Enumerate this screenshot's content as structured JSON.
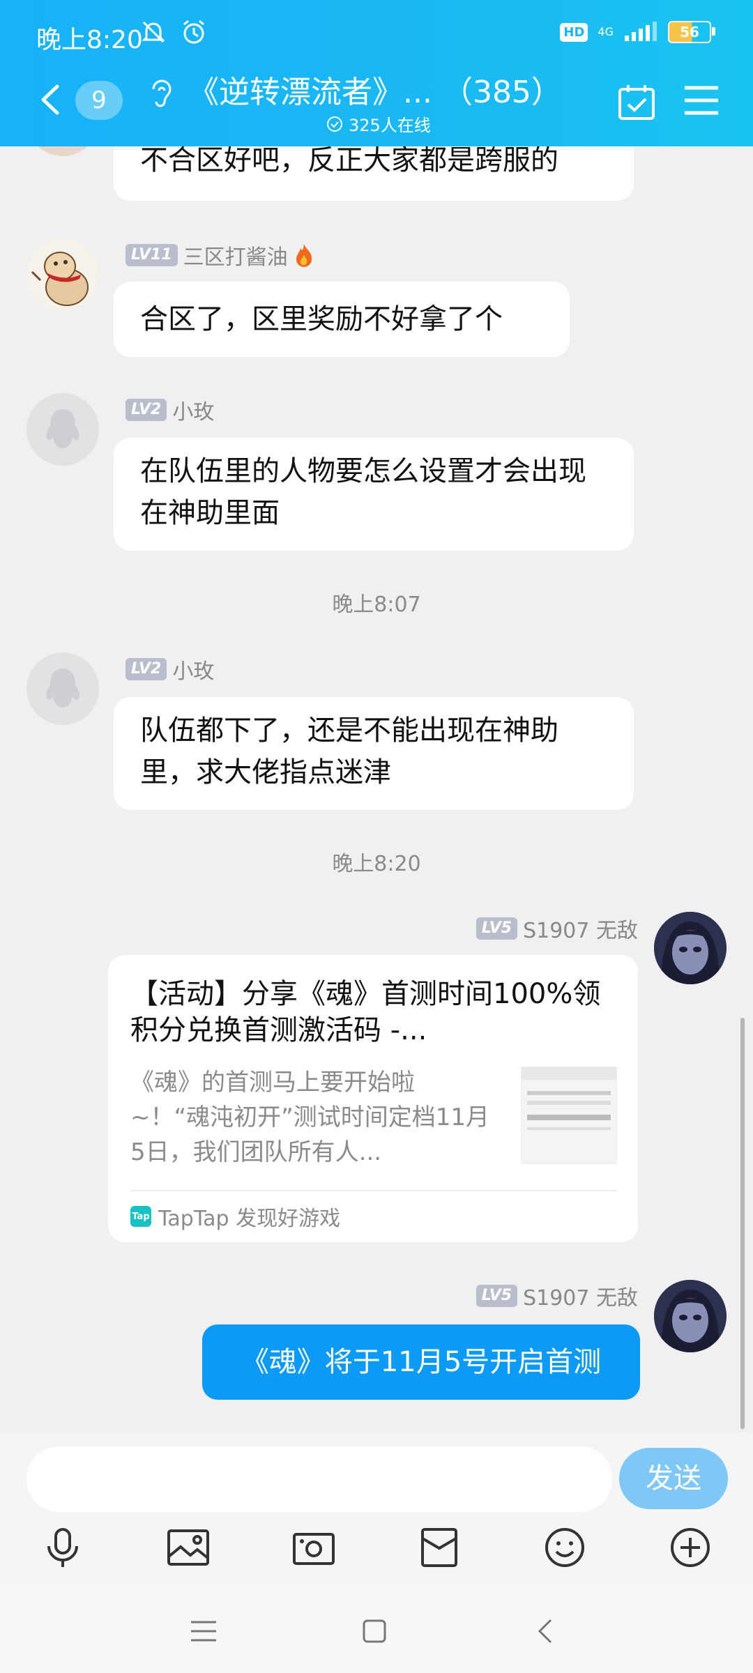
{
  "status_bar": {
    "time": "晚上8:20",
    "network": "4G",
    "battery": "56",
    "hd": "HD"
  },
  "header": {
    "unread_count": "9",
    "title": "《逆转漂流者》...  （385）",
    "online": "325人在线"
  },
  "messages": [
    {
      "sender": "",
      "level": "",
      "text": "不合区好吧，反正大家都是跨服的"
    },
    {
      "sender": "三区打酱油",
      "level": "LV11",
      "text": "合区了，区里奖励不好拿了个"
    },
    {
      "sender": "小玫",
      "level": "LV2",
      "text": "在队伍里的人物要怎么设置才会出现在神助里面"
    },
    {
      "sender": "小玫",
      "level": "LV2",
      "text": "队伍都下了，还是不能出现在神助里，求大佬指点迷津"
    }
  ],
  "times": [
    "晚上8:07",
    "晚上8:20"
  ],
  "self": {
    "sender": "S1907 无敌",
    "level": "LV5"
  },
  "share_card": {
    "title": "【活动】分享《魂》首测时间100%领积分兑换首测激活码 -...",
    "desc": "《魂》的首测马上要开始啦~！“魂沌初开”测试时间定档11月5日，我们团队所有人...",
    "source": "TapTap 发现好游戏",
    "source_logo": "Tap"
  },
  "self_message": "《魂》将于11月5号开启首测",
  "input": {
    "placeholder": "",
    "send_label": "发送"
  }
}
